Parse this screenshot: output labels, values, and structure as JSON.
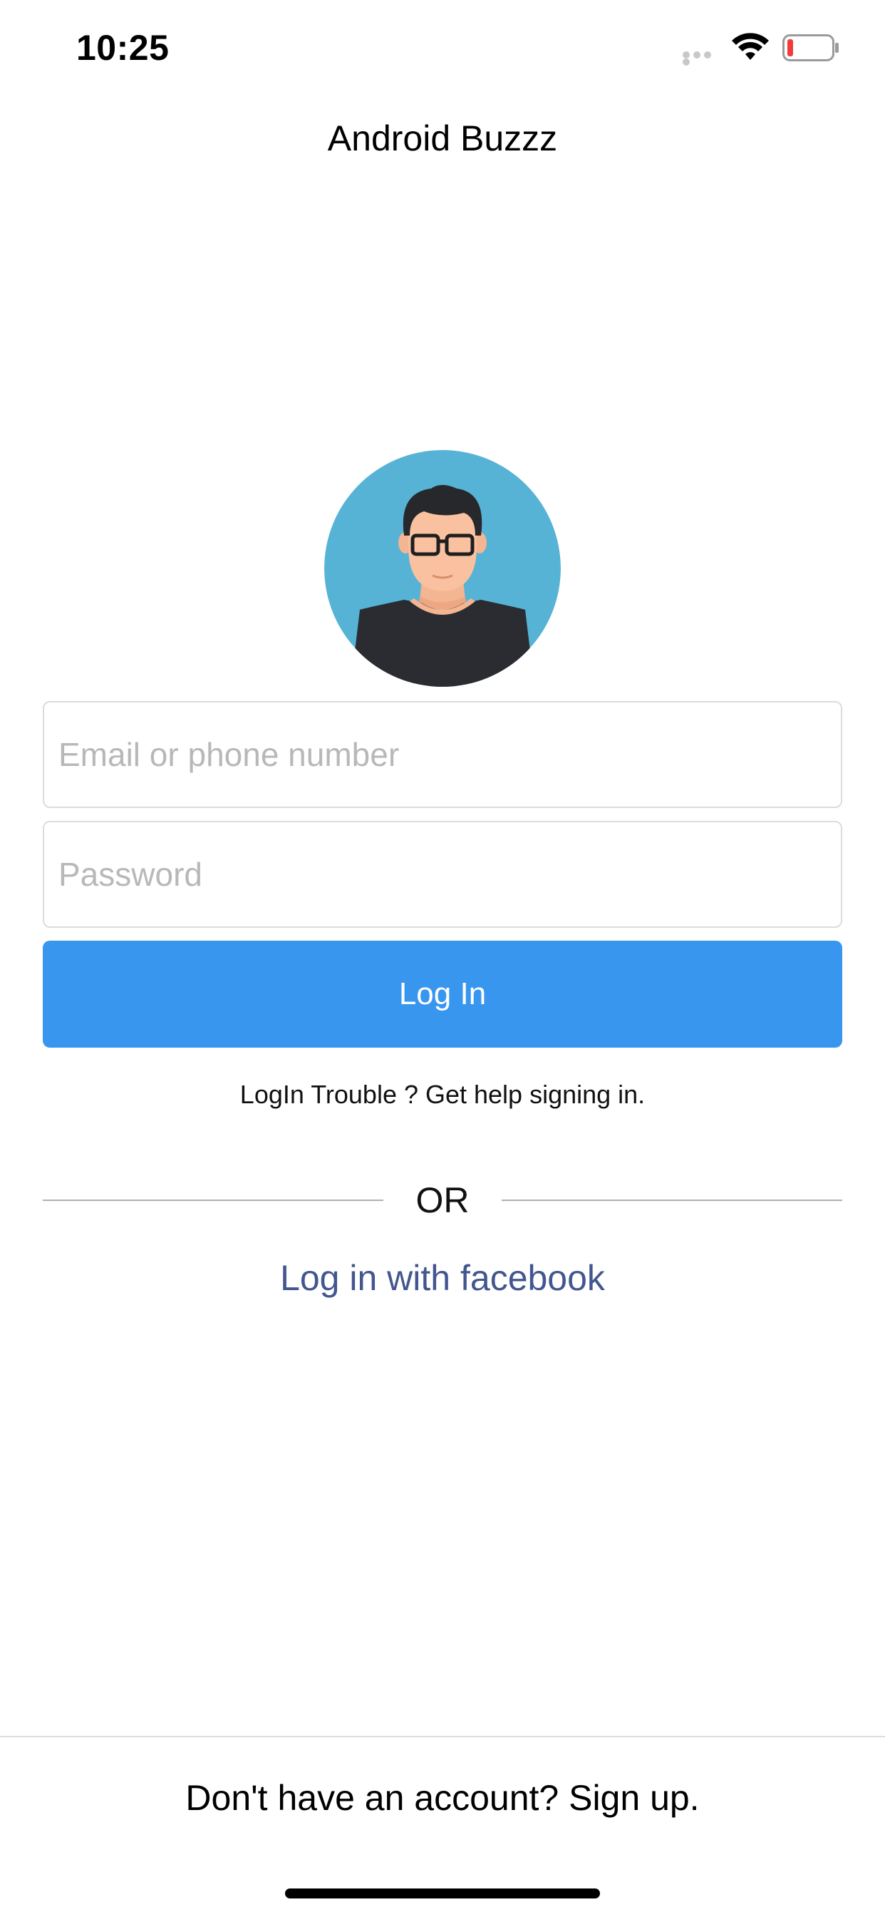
{
  "status_bar": {
    "time": "10:25",
    "battery_color": "#f23c3c"
  },
  "header": {
    "title": "Android Buzzz"
  },
  "avatar": {
    "icon": "user-avatar-icon",
    "background_color": "#57b3d5"
  },
  "form": {
    "email_placeholder": "Email or phone number",
    "email_value": "",
    "password_placeholder": "Password",
    "password_value": "",
    "login_label": "Log In",
    "login_color": "#3996ef",
    "help_text": "LogIn Trouble ? Get help signing in.",
    "or_label": "OR",
    "facebook_label": "Log in with facebook",
    "facebook_color": "#42568f"
  },
  "footer": {
    "signup_text": "Don't have an account? Sign up."
  }
}
